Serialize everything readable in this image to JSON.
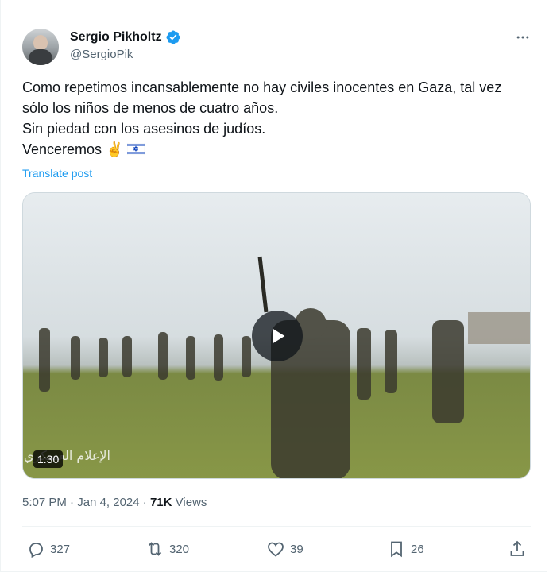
{
  "author": {
    "display_name": "Sergio Pikholtz",
    "handle": "@SergioPik"
  },
  "post": {
    "lines": [
      "Como repetimos incansablemente no hay civiles inocentes en Gaza, tal vez sólo los niños de menos de cuatro años.",
      "Sin piedad con los asesinos de judíos.",
      "Venceremos ✌️"
    ],
    "flag_icon": "israel-flag-icon",
    "translate_label": "Translate post"
  },
  "media": {
    "duration": "1:30",
    "overlay_watermark": "الإعلام العسكري"
  },
  "meta": {
    "time": "5:07 PM",
    "separator": " · ",
    "date": "Jan 4, 2024",
    "views_count": "71K",
    "views_label": " Views"
  },
  "actions": {
    "replies": "327",
    "reposts": "320",
    "likes": "39",
    "bookmarks": "26"
  },
  "colors": {
    "accent": "#1d9bf0",
    "text_primary": "#0f1419",
    "text_secondary": "#536471"
  }
}
